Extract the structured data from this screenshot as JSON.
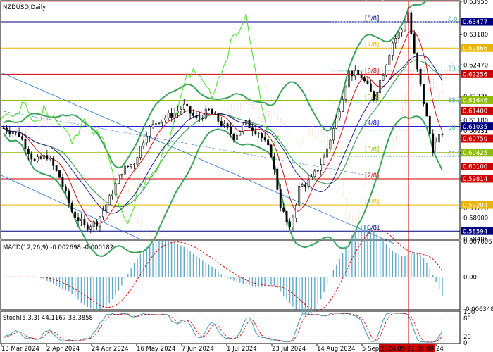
{
  "chart_data": [
    {
      "type": "candlestick",
      "title": "NZDUSD,Daily",
      "symbol": "NZDUSD",
      "timeframe": "Daily",
      "ylim": [
        0.584,
        0.6397
      ],
      "y_ticks": [
        "0.63955",
        "0.63180",
        "0.62470",
        "0.61735",
        "0.61400",
        "0.61180",
        "0.60931",
        "0.60425",
        "0.59815",
        "0.59120",
        "0.58900",
        "0.58405"
      ],
      "x_ticks": [
        "13 Mar 2024",
        "2 Apr 2024",
        "24 Apr 2024",
        "16 May 2024",
        "7 Jun 2024",
        "1 Jul 2024",
        "23 Jul 2024",
        "14 Aug 2024",
        "5 Sep 2024",
        "2024.09.27 00:00",
        "24"
      ],
      "price_levels": [
        {
          "value": 0.63477,
          "label": "0.63477",
          "bg": "#000080",
          "fg": "#ffffff"
        },
        {
          "value": 0.62866,
          "label": "0.62866",
          "bg": "#e8b400",
          "fg": "#ffffff"
        },
        {
          "value": 0.62256,
          "label": "0.62256",
          "bg": "#cc0000",
          "fg": "#ffffff"
        },
        {
          "value": 0.61646,
          "label": "0.61646",
          "bg": "#8fbc00",
          "fg": "#ffffff"
        },
        {
          "value": 0.614,
          "label": "0.61400",
          "bg": "#cc0000",
          "fg": "#ffffff"
        },
        {
          "value": 0.61035,
          "label": "0.61035",
          "bg": "#000080",
          "fg": "#ffffff"
        },
        {
          "value": 0.6075,
          "label": "0.60750",
          "bg": "#cc0000",
          "fg": "#ffffff"
        },
        {
          "value": 0.60425,
          "label": "0.60425",
          "bg": "#8fbc00",
          "fg": "#ffffff"
        },
        {
          "value": 0.601,
          "label": "0.60100",
          "bg": "#cc0000",
          "fg": "#ffffff"
        },
        {
          "value": 0.59814,
          "label": "0.59814",
          "bg": "#cc0000",
          "fg": "#ffffff"
        },
        {
          "value": 0.59204,
          "label": "0.59204",
          "bg": "#e8b400",
          "fg": "#ffffff"
        },
        {
          "value": 0.58594,
          "label": "0.58594",
          "bg": "#000080",
          "fg": "#ffffff"
        }
      ],
      "murrey_levels": [
        {
          "value": 0.6395,
          "label": "[+1/8]P",
          "color": "#ff9999"
        },
        {
          "value": 0.63477,
          "label": "[8/8]",
          "color": "#000080"
        },
        {
          "value": 0.62866,
          "label": "[7/8]",
          "color": "#e8b400"
        },
        {
          "value": 0.62256,
          "label": "[6/8]",
          "color": "#cc0000"
        },
        {
          "value": 0.61646,
          "label": "[5/8]",
          "color": "#8fbc00"
        },
        {
          "value": 0.61035,
          "label": "[4/8]",
          "color": "#0000cc"
        },
        {
          "value": 0.60425,
          "label": "[3/8]",
          "color": "#8fbc00"
        },
        {
          "value": 0.59814,
          "label": "[2/8]",
          "color": "#cc0000"
        },
        {
          "value": 0.59204,
          "label": "[1/8]",
          "color": "#e8b400"
        },
        {
          "value": 0.58594,
          "label": "[0/8]",
          "color": "#000080"
        }
      ],
      "fib_labels": [
        {
          "value": 0.63477,
          "label": "0.0"
        },
        {
          "value": 0.6233,
          "label": "23.6"
        },
        {
          "value": 0.6159,
          "label": "38.2"
        },
        {
          "value": 0.6095,
          "label": "50"
        },
        {
          "value": 0.6033,
          "label": "61.8"
        }
      ],
      "vertical_marker": "2024.09.27 00:00"
    },
    {
      "type": "line",
      "title": "MACD(12,26,9) -0.002698 -0.000182",
      "ylim": [
        -0.006348,
        0.007006
      ],
      "y_ticks": [
        "0.007006",
        "0.00",
        "-0.006348"
      ]
    },
    {
      "type": "line",
      "title": "Stoch(5,3,3) 44.1167 33.3858",
      "ylim": [
        0,
        100
      ],
      "y_ticks": [
        "100",
        "80",
        "20",
        "0"
      ]
    }
  ]
}
